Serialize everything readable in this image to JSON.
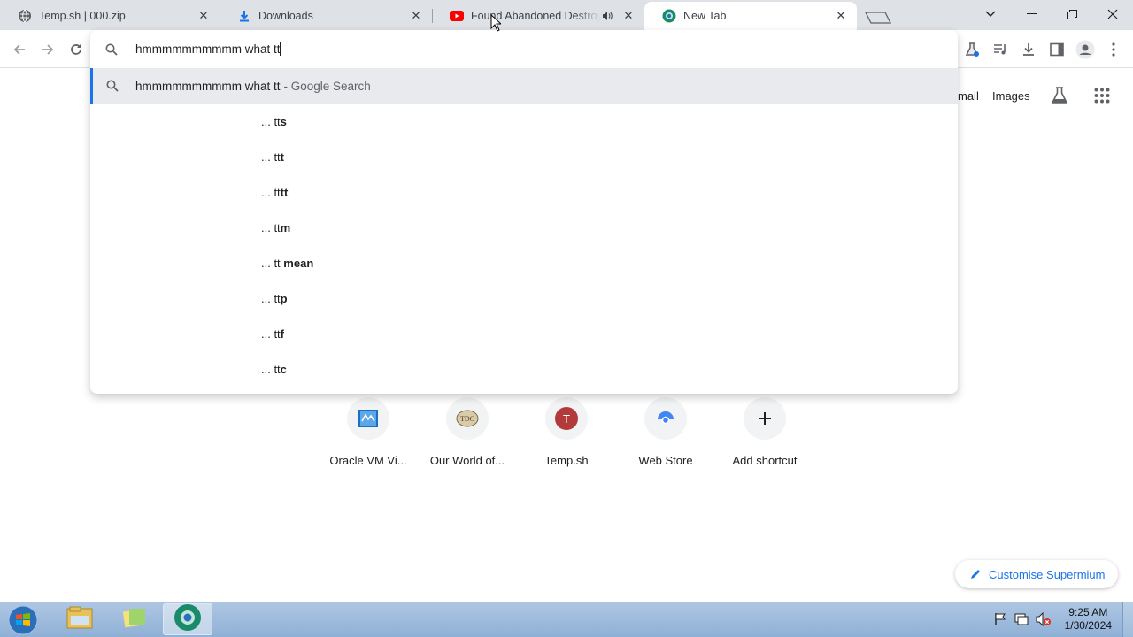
{
  "tabs": [
    {
      "title": "Temp.sh | 000.zip",
      "favicon": "globe-icon"
    },
    {
      "title": "Downloads",
      "favicon": "download-icon"
    },
    {
      "title": "Found Abandoned Destroyed",
      "favicon": "youtube-icon",
      "audio": "speaker-icon"
    },
    {
      "title": "New Tab",
      "favicon": "supermium-icon"
    }
  ],
  "omnibox": {
    "query": "hmmmmmmmmmm what tt",
    "selected": {
      "query": "hmmmmmmmmmm what tt",
      "suffix": "- Google Search"
    },
    "suggestions": [
      {
        "prefix": "... tt",
        "bold": "s"
      },
      {
        "prefix": "... tt",
        "bold": "t"
      },
      {
        "prefix": "... tt",
        "bold": "tt"
      },
      {
        "prefix": "... tt",
        "bold": "m"
      },
      {
        "prefix": "... tt ",
        "bold": "mean"
      },
      {
        "prefix": "... tt",
        "bold": "p"
      },
      {
        "prefix": "... tt",
        "bold": "f"
      },
      {
        "prefix": "... tt",
        "bold": "c"
      }
    ]
  },
  "ntp": {
    "links": {
      "mail": "mail",
      "images": "Images"
    },
    "shortcuts": [
      {
        "label": "Oracle VM Vi...",
        "icon": "virtualbox-icon"
      },
      {
        "label": "Our World of...",
        "icon": "site-icon"
      },
      {
        "label": "Temp.sh",
        "icon": "letter-t-icon",
        "letter": "T"
      },
      {
        "label": "Web Store",
        "icon": "webstore-icon"
      },
      {
        "label": "Add shortcut",
        "icon": "plus-icon"
      }
    ],
    "customise": "Customise Supermium"
  },
  "taskbar": {
    "time": "9:25 AM",
    "date": "1/30/2024"
  },
  "colors": {
    "accent": "#1a73e8",
    "youtube": "#ff0000",
    "temp_avatar": "#b23a3a"
  }
}
